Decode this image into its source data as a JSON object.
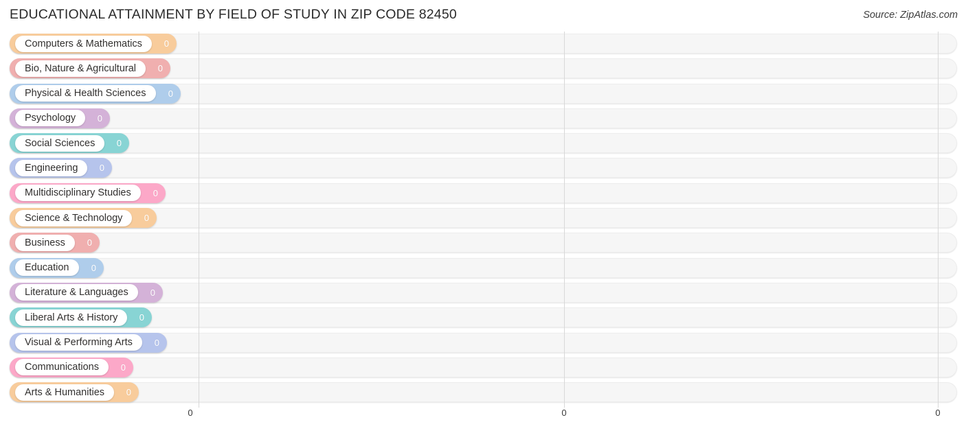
{
  "header": {
    "title": "EDUCATIONAL ATTAINMENT BY FIELD OF STUDY IN ZIP CODE 82450",
    "source": "Source: ZipAtlas.com"
  },
  "chart_data": {
    "type": "bar",
    "orientation": "horizontal",
    "title": "EDUCATIONAL ATTAINMENT BY FIELD OF STUDY IN ZIP CODE 82450",
    "xlabel": "",
    "ylabel": "",
    "xlim": [
      0,
      0
    ],
    "grid": true,
    "legend": "none",
    "xticks": [
      "0",
      "0",
      "0"
    ],
    "categories": [
      "Computers & Mathematics",
      "Bio, Nature & Agricultural",
      "Physical & Health Sciences",
      "Psychology",
      "Social Sciences",
      "Engineering",
      "Multidisciplinary Studies",
      "Science & Technology",
      "Business",
      "Education",
      "Literature & Languages",
      "Liberal Arts & History",
      "Visual & Performing Arts",
      "Communications",
      "Arts & Humanities"
    ],
    "values": [
      0,
      0,
      0,
      0,
      0,
      0,
      0,
      0,
      0,
      0,
      0,
      0,
      0,
      0,
      0
    ],
    "value_labels": [
      "0",
      "0",
      "0",
      "0",
      "0",
      "0",
      "0",
      "0",
      "0",
      "0",
      "0",
      "0",
      "0",
      "0",
      "0"
    ],
    "colors": [
      "#F8CC9C",
      "#F0AFAF",
      "#AFCDEB",
      "#D4B2D8",
      "#88D4D4",
      "#B6C4EC",
      "#FCA8C8",
      "#F8CC9C",
      "#F0AFAF",
      "#AFCDEB",
      "#D4B2D8",
      "#88D4D4",
      "#B6C4EC",
      "#FCA8C8",
      "#F8CC9C"
    ]
  }
}
